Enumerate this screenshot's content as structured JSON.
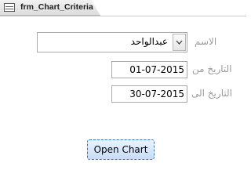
{
  "tab": {
    "title": "frm_Chart_Criteria",
    "icon": "form-icon"
  },
  "name_field": {
    "label": "الاسم",
    "value": "عبدالواحد",
    "icon": "chevron-down-icon"
  },
  "date_from": {
    "label": "التاريخ من",
    "value": "01-07-2015"
  },
  "date_to": {
    "label": "التاريخ الى",
    "value": "30-07-2015"
  },
  "open_chart_button": {
    "label": "Open Chart"
  },
  "colors": {
    "button_fill": "#d6e6fb",
    "button_border": "#3c6fb0",
    "label_text": "#9c9c9c"
  }
}
